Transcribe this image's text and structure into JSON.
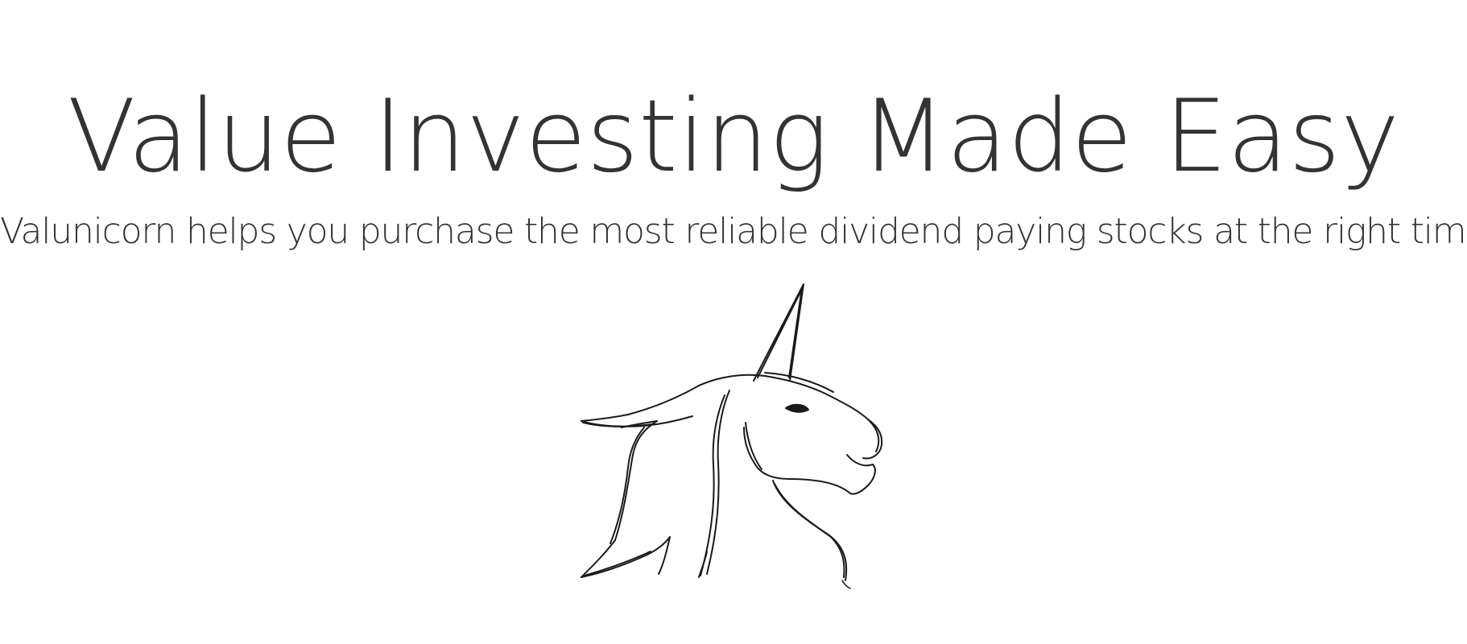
{
  "hero": {
    "title": "Value Investing Made Easy",
    "subtitle": "Valunicorn helps you purchase the most reliable dividend paying stocks at the right time."
  },
  "logo": {
    "icon": "unicorn-sketch-icon",
    "stroke_color": "#1a1a1a"
  },
  "colors": {
    "background": "#ffffff",
    "text": "#333333"
  }
}
